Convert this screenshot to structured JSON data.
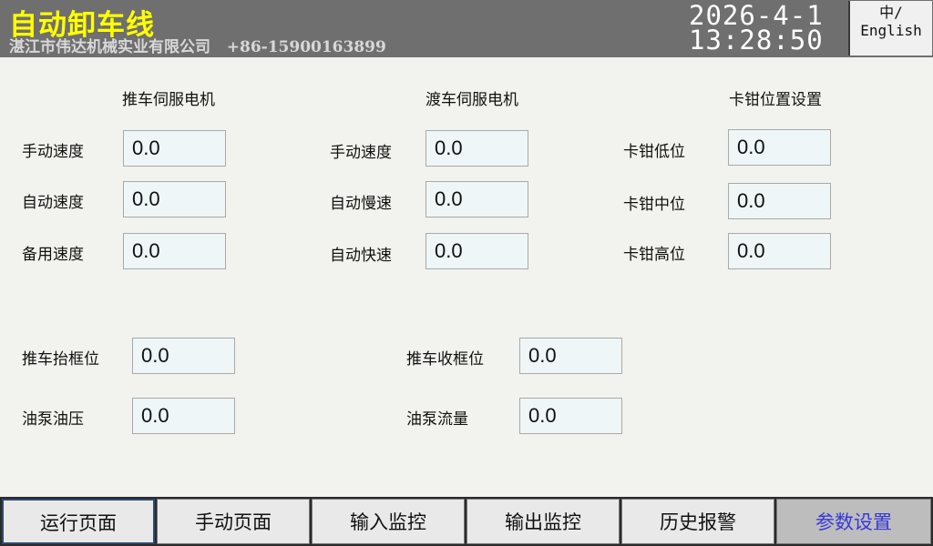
{
  "header": {
    "title": "自动卸车线",
    "company": "湛江市伟达机械实业有限公司   +86-15900163899",
    "date": "2026-4-1",
    "time": "13:28:50",
    "lang_line1": "中/",
    "lang_line2": "English"
  },
  "sections": {
    "push_servo": "推车伺服电机",
    "ferry_servo": "渡车伺服电机",
    "clamp_position": "卡钳位置设置"
  },
  "push_servo": {
    "manual_speed": {
      "label": "手动速度",
      "value": "0.0"
    },
    "auto_speed": {
      "label": "自动速度",
      "value": "0.0"
    },
    "spare_speed": {
      "label": "备用速度",
      "value": "0.0"
    }
  },
  "ferry_servo": {
    "manual_speed": {
      "label": "手动速度",
      "value": "0.0"
    },
    "auto_slow": {
      "label": "自动慢速",
      "value": "0.0"
    },
    "auto_fast": {
      "label": "自动快速",
      "value": "0.0"
    }
  },
  "clamp": {
    "low": {
      "label": "卡钳低位",
      "value": "0.0"
    },
    "mid": {
      "label": "卡钳中位",
      "value": "0.0"
    },
    "high": {
      "label": "卡钳高位",
      "value": "0.0"
    }
  },
  "lower": {
    "lift_frame": {
      "label": "推车抬框位",
      "value": "0.0"
    },
    "retract_frame": {
      "label": "推车收框位",
      "value": "0.0"
    },
    "pump_pressure": {
      "label": "油泵油压",
      "value": "0.0"
    },
    "pump_flow": {
      "label": "油泵流量",
      "value": "0.0"
    }
  },
  "nav": {
    "run": "运行页面",
    "manual": "手动页面",
    "input_monitor": "输入监控",
    "output_monitor": "输出监控",
    "alarm_history": "历史报警",
    "params": "参数设置"
  },
  "colors": {
    "header_bg": "#6f6f6f",
    "title": "#ffff00",
    "field_bg": "#eef6f7",
    "active_nav_text": "#3838d8"
  }
}
